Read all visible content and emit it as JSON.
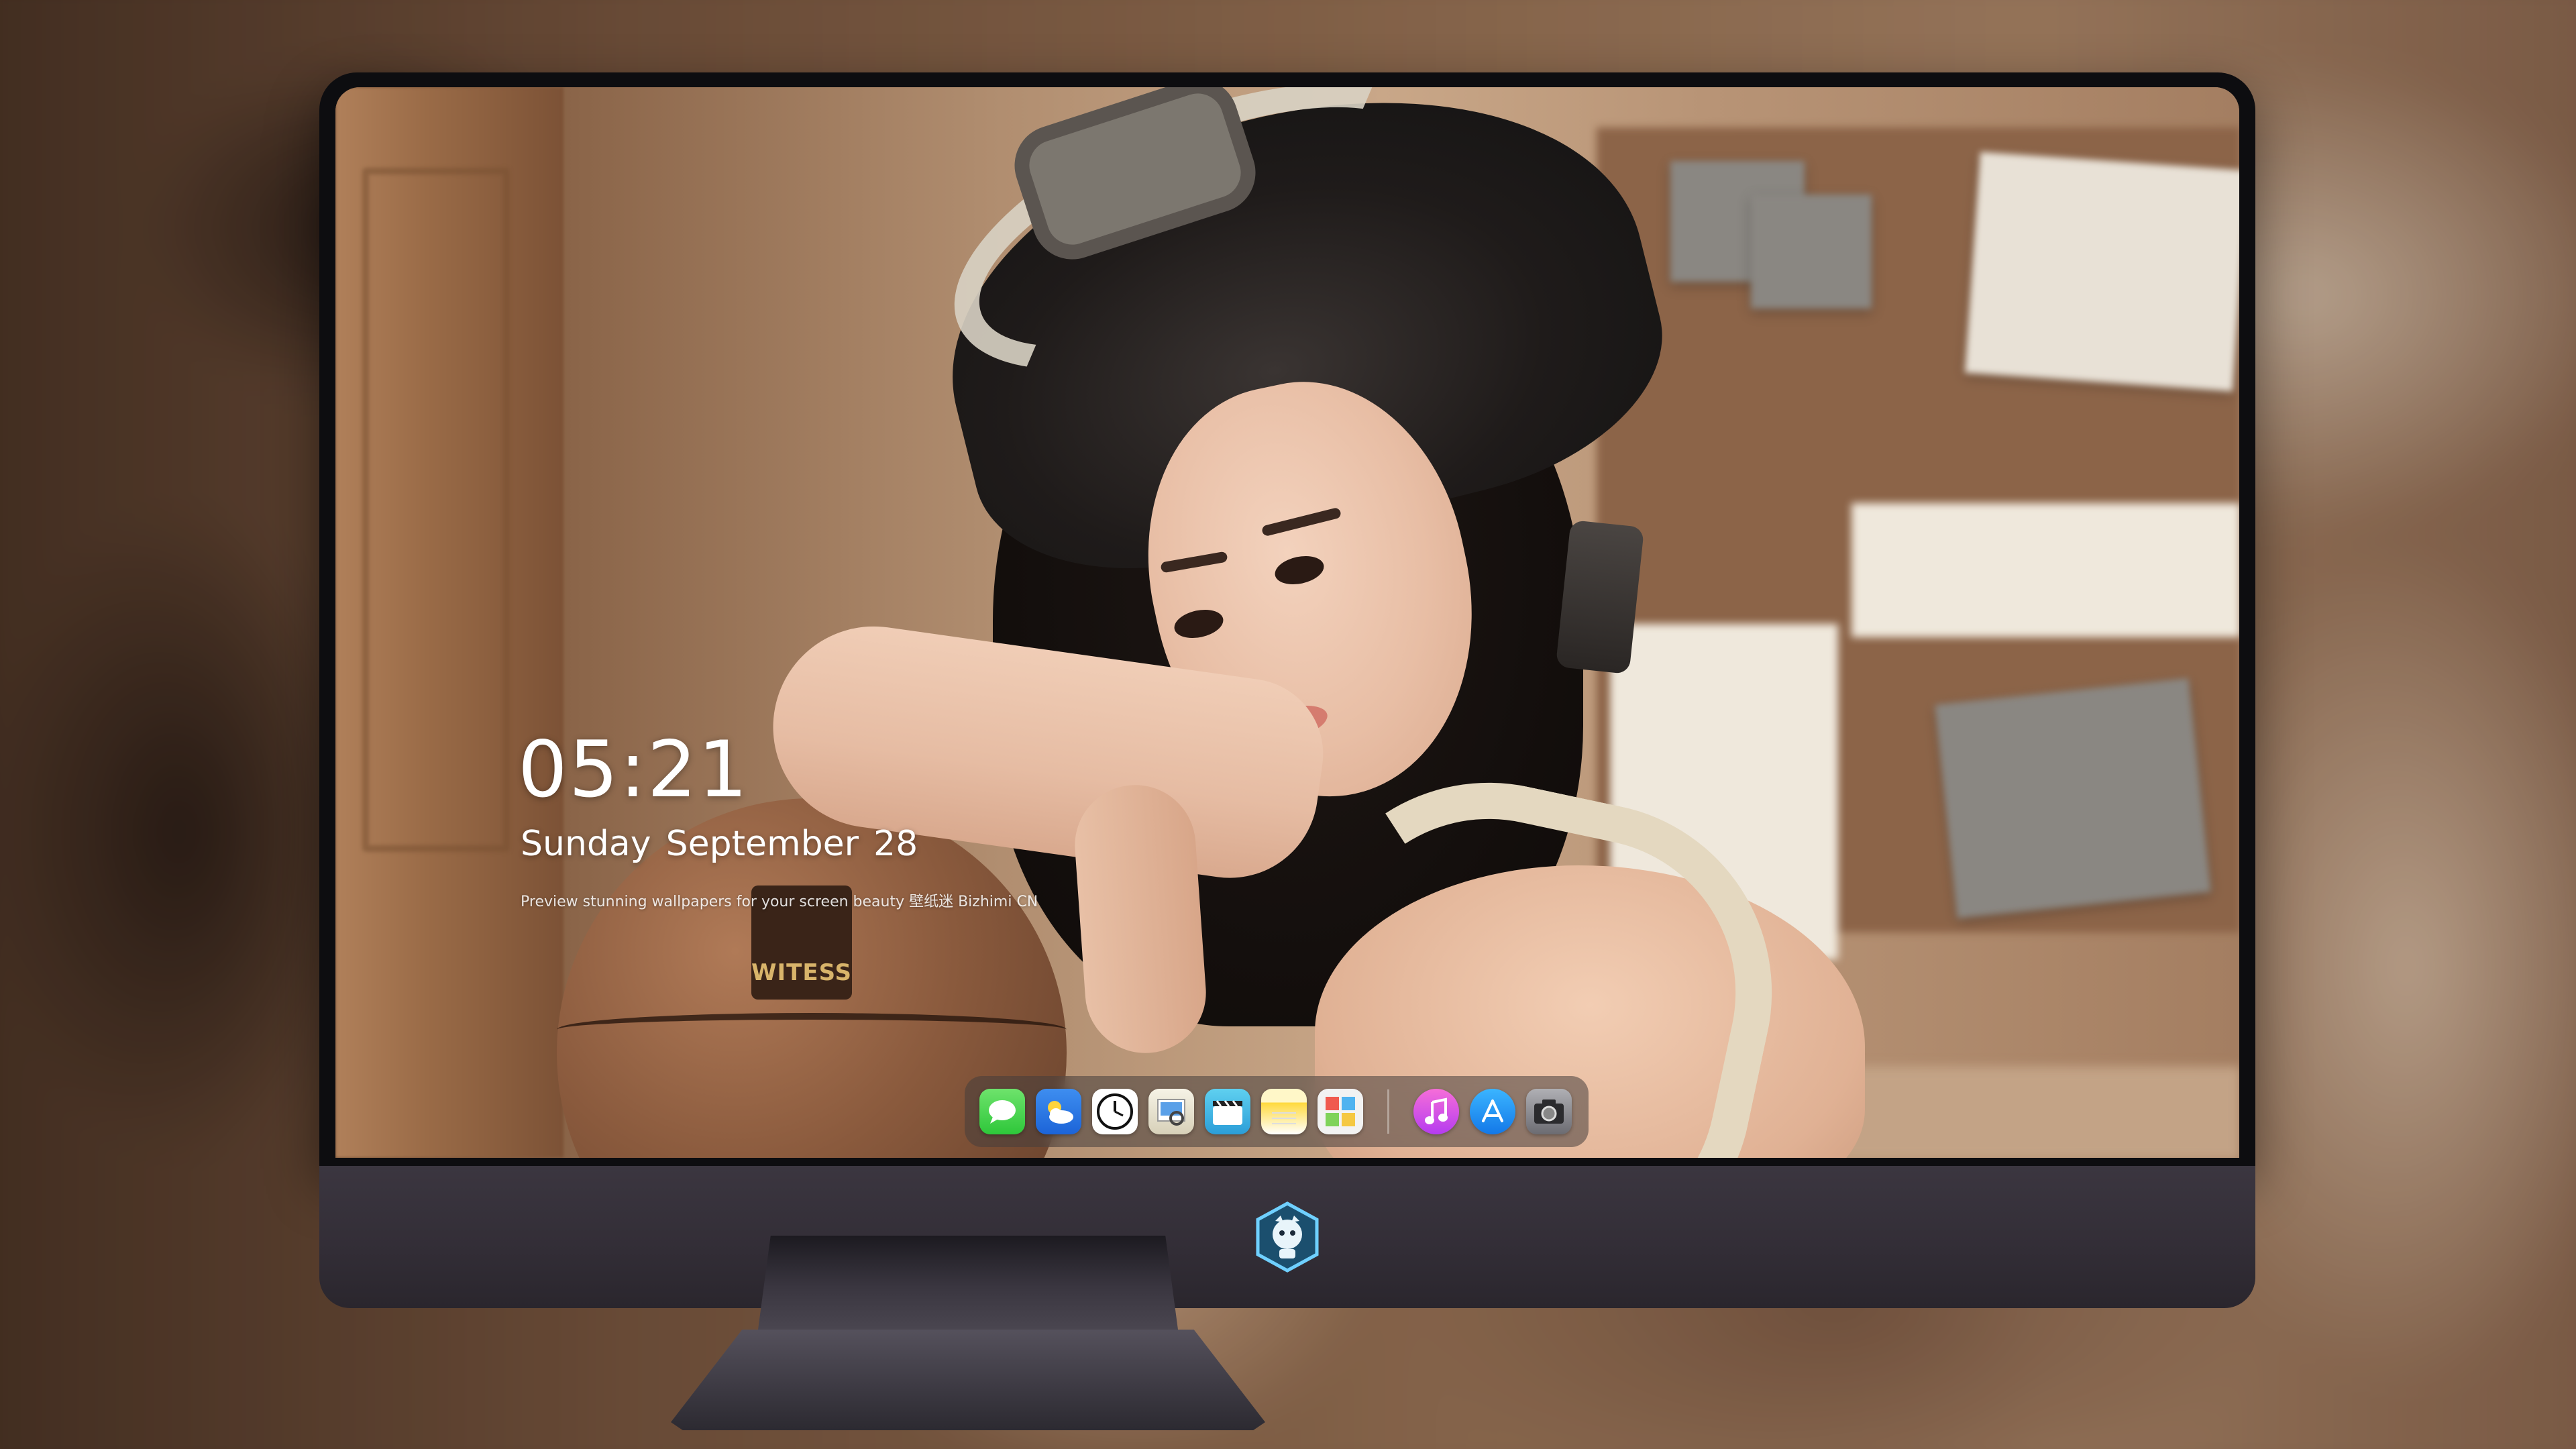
{
  "lockscreen": {
    "time": "05:21",
    "weekday": "Sunday",
    "month": "September",
    "day": "28",
    "tagline": "Preview stunning wallpapers for your screen beauty  壁纸迷 Bizhimi CN"
  },
  "wallpaper": {
    "basketball_brand": "WITESS"
  },
  "dock": {
    "apps": [
      {
        "name": "Messages",
        "icon": "messages-icon"
      },
      {
        "name": "Weather",
        "icon": "weather-icon"
      },
      {
        "name": "Clock",
        "icon": "clock-icon"
      },
      {
        "name": "Preview",
        "icon": "preview-icon"
      },
      {
        "name": "Clips",
        "icon": "clips-icon"
      },
      {
        "name": "Notes",
        "icon": "notes-icon"
      },
      {
        "name": "Photos",
        "icon": "photos-icon"
      },
      {
        "name": "iTunes",
        "icon": "music-icon"
      },
      {
        "name": "App Store",
        "icon": "app-store-icon"
      },
      {
        "name": "Camera",
        "icon": "camera-icon"
      }
    ]
  },
  "colors": {
    "bezel": "#0d0d10",
    "chin": "#332e37",
    "dock_bg": "rgba(70,62,60,0.55)",
    "clock_text": "#ffffff"
  }
}
